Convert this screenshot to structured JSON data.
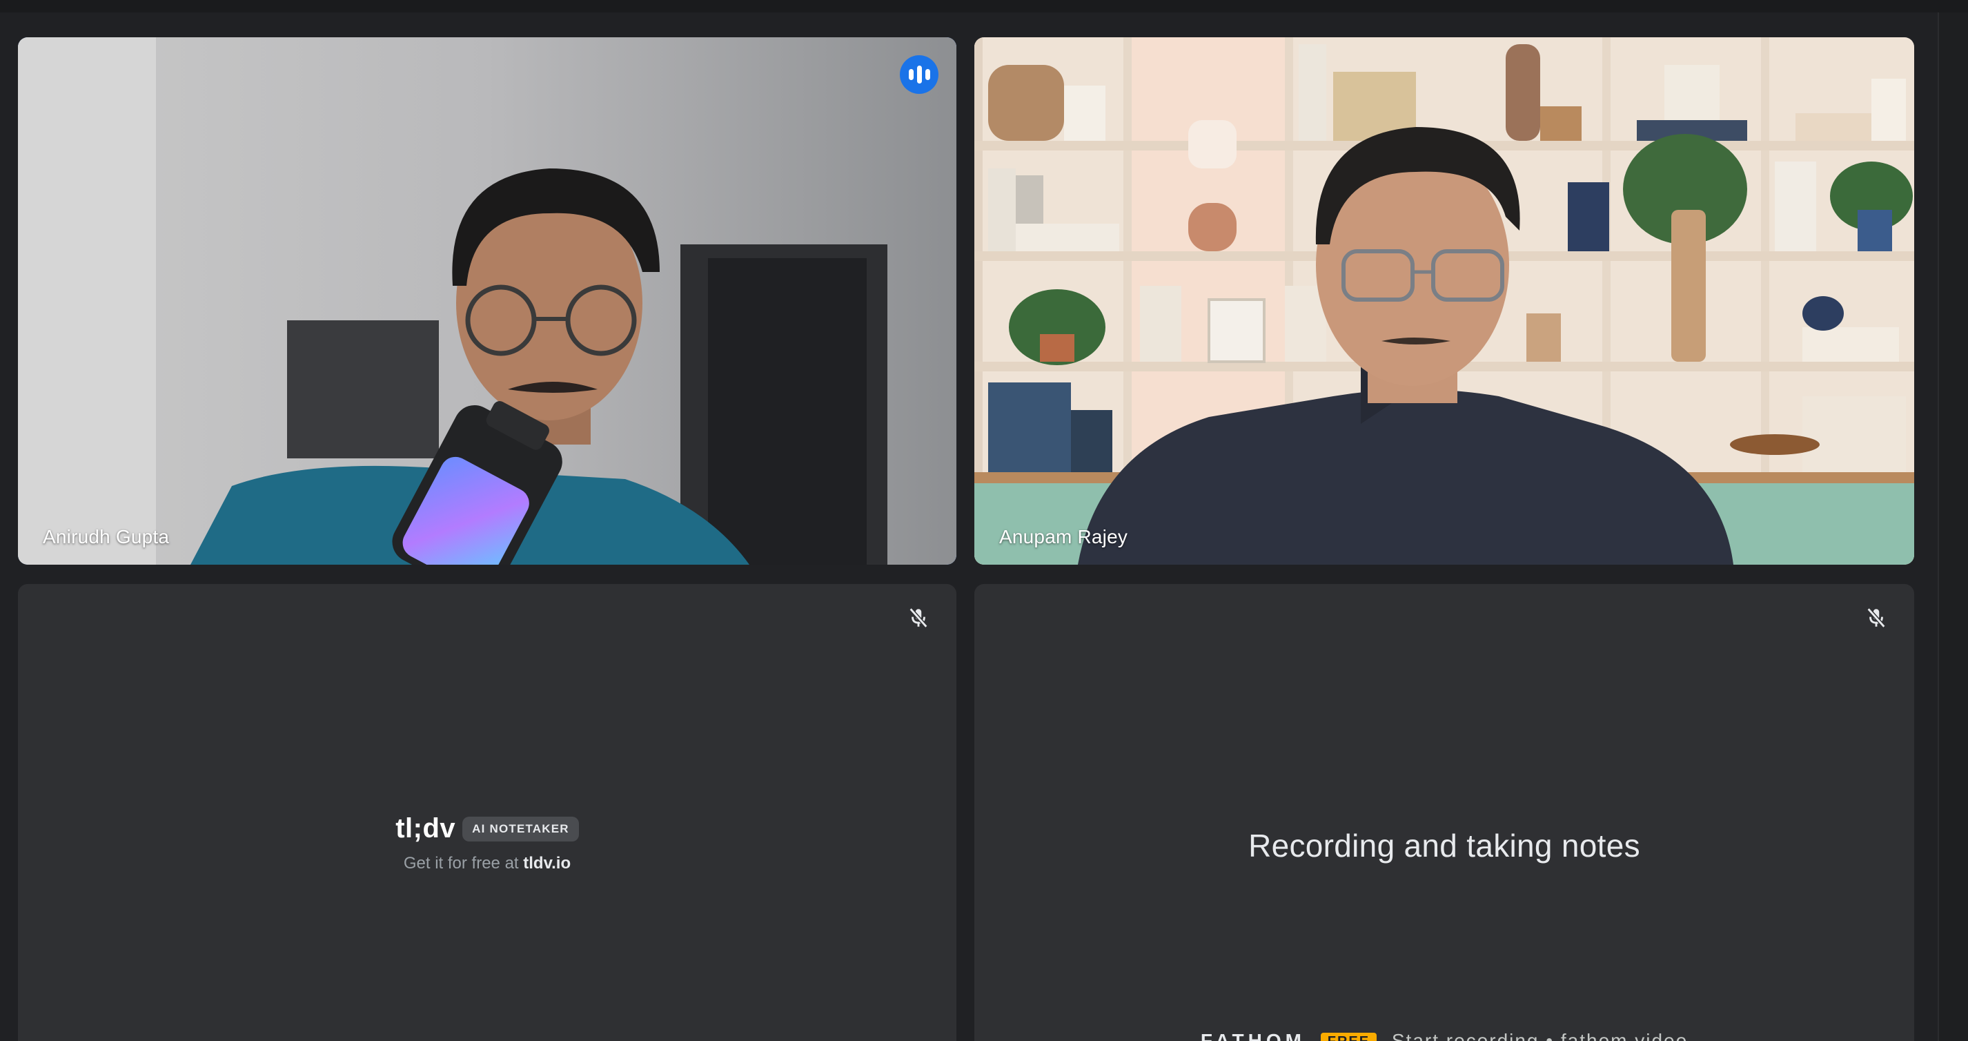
{
  "meeting": {
    "tiles": [
      {
        "participant_name": "Anirudh Gupta",
        "state": "speaking",
        "speaking_icon": "audio-bars-icon"
      },
      {
        "participant_name": "Anupam Rajey",
        "state": "video"
      },
      {
        "bot": "tldv",
        "mic_icon": "mic-off-icon",
        "logo_text": "tl;dv",
        "chip_text": "AI NOTETAKER",
        "tagline_prefix": "Get it for free at ",
        "tagline_link": "tldv.io"
      },
      {
        "bot": "fathom",
        "mic_icon": "mic-off-icon",
        "status_text": "Recording and taking notes",
        "footer_logo": "FATHOM",
        "footer_badge": "FREE",
        "footer_text": "Start recording  •  fathom.video"
      }
    ]
  },
  "colors": {
    "background": "#202124",
    "active_speaker_border": "#8ab4f8",
    "speaking_badge": "#1a73e8",
    "bot_tile": "#2f3033"
  }
}
